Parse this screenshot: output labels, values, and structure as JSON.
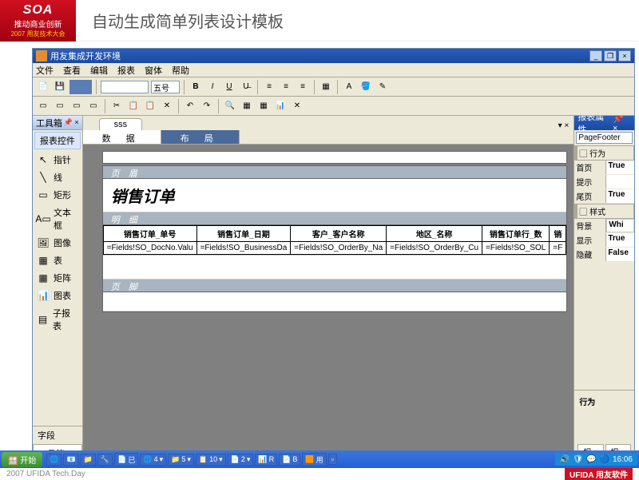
{
  "slide": {
    "logo_top": "SOA",
    "logo_mid": "推动商业创新",
    "logo_year": "2007 用友技术大会",
    "title": "自动生成简单列表设计模板",
    "footer": "2007 UFIDA Tech.Day",
    "ufida": "UFIDA 用友软件"
  },
  "window": {
    "title": "用友集成开发环境",
    "menus": [
      "文件",
      "查看",
      "编辑",
      "报表",
      "窗体",
      "帮助"
    ],
    "font_combo": "",
    "size_combo": "五号"
  },
  "toolbox": {
    "header": "工具箱",
    "category": "报表控件",
    "items": [
      {
        "icon": "↖",
        "label": "指针"
      },
      {
        "icon": "╲",
        "label": "线"
      },
      {
        "icon": "▭",
        "label": "矩形"
      },
      {
        "icon": "A▭",
        "label": "文本框"
      },
      {
        "icon": "🖼",
        "label": "图像"
      },
      {
        "icon": "▦",
        "label": "表"
      },
      {
        "icon": "▦",
        "label": "矩阵"
      },
      {
        "icon": "📊",
        "label": "图表"
      },
      {
        "icon": "▤",
        "label": "子报表"
      }
    ],
    "bottom_tabs": [
      "字段",
      "工具箱"
    ]
  },
  "doc": {
    "tab": "sss",
    "subtabs": [
      "数  据",
      "布  局"
    ],
    "sections": {
      "header": "页 眉",
      "title": "销售订单",
      "detail": "明 细",
      "footer": "页  脚"
    },
    "columns": [
      "销售订单_单号",
      "销售订单_日期",
      "客户_客户名称",
      "地区_名称",
      "销售订单行_数",
      "销"
    ],
    "fields": [
      "=Fields!SO_DocNo.Valu",
      "=Fields!SO_BusinessDa",
      "=Fields!SO_OrderBy_Na",
      "=Fields!SO_OrderBy_Cu",
      "=Fields!SO_SOL",
      "=F"
    ]
  },
  "props": {
    "header": "报表属性",
    "selector": "PageFooter",
    "cat1": "行为",
    "rows1": [
      {
        "k": "首页",
        "v": "True"
      },
      {
        "k": "提示",
        "v": ""
      },
      {
        "k": "尾页",
        "v": "True"
      }
    ],
    "cat2": "样式",
    "rows2": [
      {
        "k": "背景",
        "v": "Whi"
      },
      {
        "k": "显示",
        "v": "True"
      },
      {
        "k": "隐藏",
        "v": "False"
      }
    ],
    "bottom_label": "行为",
    "btabs": [
      "报...",
      "报..."
    ]
  },
  "taskbar": {
    "start": "开始",
    "items": [
      "已",
      "4",
      "5",
      "10",
      "2",
      "R",
      "B",
      "用"
    ],
    "time": "16:06"
  }
}
